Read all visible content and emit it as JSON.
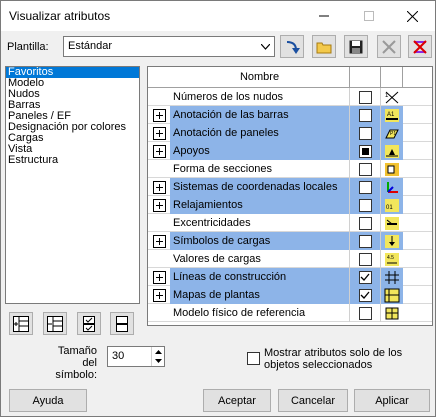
{
  "window": {
    "title": "Visualizar atributos"
  },
  "template": {
    "label": "Plantilla:",
    "value": "Estándar"
  },
  "toolbar": [
    "apply-template-icon",
    "open-folder-icon",
    "save-icon",
    "delete-icon",
    "clear-icon"
  ],
  "left_list": [
    "Favoritos",
    "Modelo",
    "Nudos",
    "Barras",
    "Paneles / EF",
    "Designación por colores",
    "Cargas",
    "Vista",
    "Estructura"
  ],
  "left_selected": 0,
  "grid": {
    "header": "Nombre",
    "rows": [
      {
        "label": "Números de los nudos",
        "group": false,
        "checked": "unchecked",
        "icon": "node-numbers-icon"
      },
      {
        "label": "Anotación de las barras",
        "group": true,
        "checked": "unchecked",
        "icon": "member-annotation-icon"
      },
      {
        "label": "Anotación de paneles",
        "group": true,
        "checked": "unchecked",
        "icon": "panel-annotation-icon"
      },
      {
        "label": "Apoyos",
        "group": true,
        "checked": "filled",
        "icon": "supports-icon"
      },
      {
        "label": "Forma de secciones",
        "group": false,
        "checked": "unchecked",
        "icon": "section-shape-icon"
      },
      {
        "label": "Sistemas de coordenadas locales",
        "group": true,
        "checked": "unchecked",
        "icon": "local-coordinate-icon"
      },
      {
        "label": "Relajamientos",
        "group": true,
        "checked": "unchecked",
        "icon": "releases-icon"
      },
      {
        "label": "Excentricidades",
        "group": false,
        "checked": "unchecked",
        "icon": "eccentricity-icon"
      },
      {
        "label": "Símbolos de cargas",
        "group": true,
        "checked": "unchecked",
        "icon": "load-symbols-icon"
      },
      {
        "label": "Valores de cargas",
        "group": false,
        "checked": "unchecked",
        "icon": "load-values-icon"
      },
      {
        "label": "Líneas de construcción",
        "group": true,
        "checked": "checked",
        "icon": "construction-lines-icon"
      },
      {
        "label": "Mapas de plantas",
        "group": true,
        "checked": "checked",
        "icon": "floor-maps-icon"
      },
      {
        "label": "Modelo físico de referencia",
        "group": false,
        "checked": "unchecked",
        "icon": "physical-model-icon"
      }
    ]
  },
  "symbol_size": {
    "label": "Tamaño del símbolo:",
    "value": "30"
  },
  "show_selected": {
    "label": "Mostrar atributos solo de los objetos seleccionados",
    "checked": false
  },
  "buttons": {
    "help": "Ayuda",
    "accept": "Aceptar",
    "cancel": "Cancelar",
    "apply": "Aplicar"
  },
  "colors": {
    "group_row": "#8db4e8",
    "selection": "#0078d7"
  }
}
